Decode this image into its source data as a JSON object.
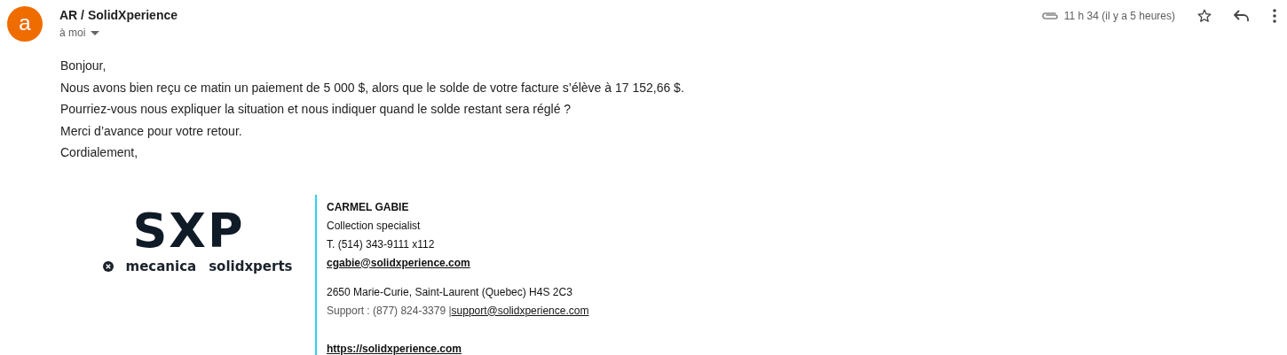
{
  "header": {
    "avatar_letter": "a",
    "sender": "AR / SolidXperience",
    "recipient": "à moi",
    "has_attachment": true,
    "time": "11 h 34 (il y a 5 heures)",
    "starred": false
  },
  "body": [
    "Bonjour,",
    "Nous avons bien reçu ce matin un paiement de 5 000 $, alors que le solde de votre facture s’élève à 17 152,66 $.",
    "Pourriez-vous nous expliquer la situation et nous indiquer quand le solde restant sera réglé ?",
    "Merci d’avance pour votre retour.",
    "Cordialement,"
  ],
  "signature": {
    "logo": {
      "mark": "SXP",
      "brands": [
        "mecanica",
        "solidxperts"
      ]
    },
    "name": "CARMEL GABIE",
    "role": "Collection specialist",
    "phone": "T. (514) 343-9111 x112",
    "email": "cgabie@solidxperience.com",
    "address": "2650 Marie-Curie, Saint-Laurent (Quebec) H4S 2C3",
    "support": "Support : (877) 824-3379 |",
    "support_email": "support@solidxperience.com",
    "website": "https://solidxperience.com"
  }
}
